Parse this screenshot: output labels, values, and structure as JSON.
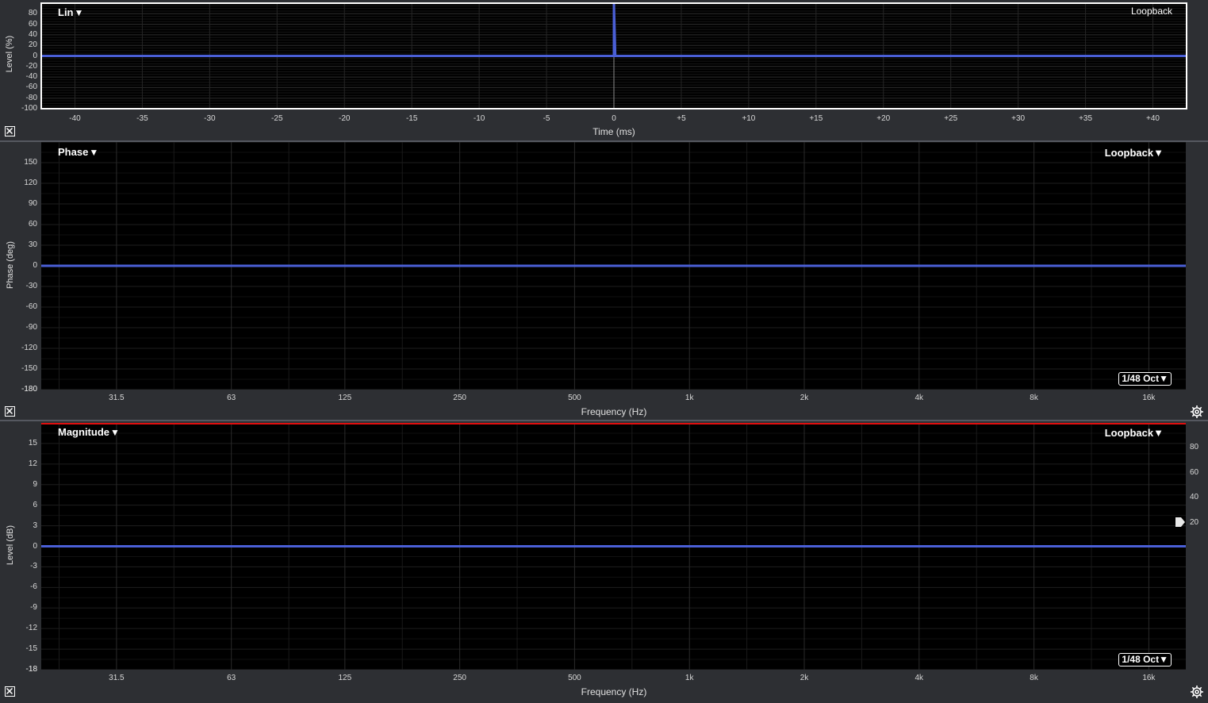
{
  "impulse_panel": {
    "mode_label": "Lin",
    "source_label": "Loopback",
    "ylabel": "Level (%)",
    "xlabel": "Time (ms)",
    "y_ticks": [
      "80",
      "60",
      "40",
      "20",
      "0",
      "-20",
      "-40",
      "-60",
      "-80",
      "-100"
    ],
    "x_ticks": [
      "-40",
      "-35",
      "-30",
      "-25",
      "-20",
      "-15",
      "-10",
      "-5",
      "0",
      "+5",
      "+10",
      "+15",
      "+20",
      "+25",
      "+30",
      "+35",
      "+40"
    ]
  },
  "phase_panel": {
    "mode_label": "Phase",
    "source_label": "Loopback",
    "smoothing_label": "1/48 Oct",
    "ylabel": "Phase (deg)",
    "xlabel": "Frequency (Hz)",
    "y_ticks": [
      "150",
      "120",
      "90",
      "60",
      "30",
      "0",
      "-30",
      "-60",
      "-90",
      "-120",
      "-150",
      "-180"
    ],
    "x_ticks": [
      "31.5",
      "63",
      "125",
      "250",
      "500",
      "1k",
      "2k",
      "4k",
      "8k",
      "16k"
    ]
  },
  "magnitude_panel": {
    "mode_label": "Magnitude",
    "source_label": "Loopback",
    "smoothing_label": "1/48 Oct",
    "ylabel": "Level (dB)",
    "xlabel": "Frequency (Hz)",
    "y_ticks": [
      "15",
      "12",
      "9",
      "6",
      "3",
      "0",
      "-3",
      "-6",
      "-9",
      "-12",
      "-15",
      "-18"
    ],
    "x_ticks": [
      "31.5",
      "63",
      "125",
      "250",
      "500",
      "1k",
      "2k",
      "4k",
      "8k",
      "16k"
    ],
    "right_ticks": [
      "80",
      "60",
      "40",
      "20"
    ]
  },
  "chart_data": [
    {
      "type": "line",
      "xlabel": "Time (ms)",
      "ylabel": "Level (%)",
      "xlim": [
        -42.5,
        42.5
      ],
      "ylim": [
        -100,
        100
      ],
      "series": [
        {
          "x": [
            -42.5,
            -0.1,
            0,
            0,
            0.1,
            42.5
          ],
          "y": [
            0,
            0,
            0,
            100,
            0,
            0
          ]
        }
      ],
      "grid": true,
      "colors": {
        "trace": "#4a5fd6",
        "background": "#000000"
      }
    },
    {
      "type": "line",
      "xlabel": "Frequency (Hz)",
      "ylabel": "Phase (deg)",
      "xscale": "log",
      "xlim": [
        20,
        20000
      ],
      "ylim": [
        -180,
        180
      ],
      "series": [
        {
          "x": [
            20,
            20000
          ],
          "y": [
            0,
            0
          ]
        }
      ],
      "grid": true,
      "colors": {
        "trace": "#4a5fd6",
        "background": "#000000"
      }
    },
    {
      "type": "line",
      "xlabel": "Frequency (Hz)",
      "ylabel": "Level (dB)",
      "xscale": "log",
      "xlim": [
        20,
        20000
      ],
      "ylim": [
        -18,
        18
      ],
      "series": [
        {
          "x": [
            20,
            20000
          ],
          "y": [
            0,
            0
          ]
        }
      ],
      "grid": true,
      "colors": {
        "trace": "#4a5fd6",
        "background": "#000000",
        "top_marker": "#e01010"
      }
    }
  ]
}
